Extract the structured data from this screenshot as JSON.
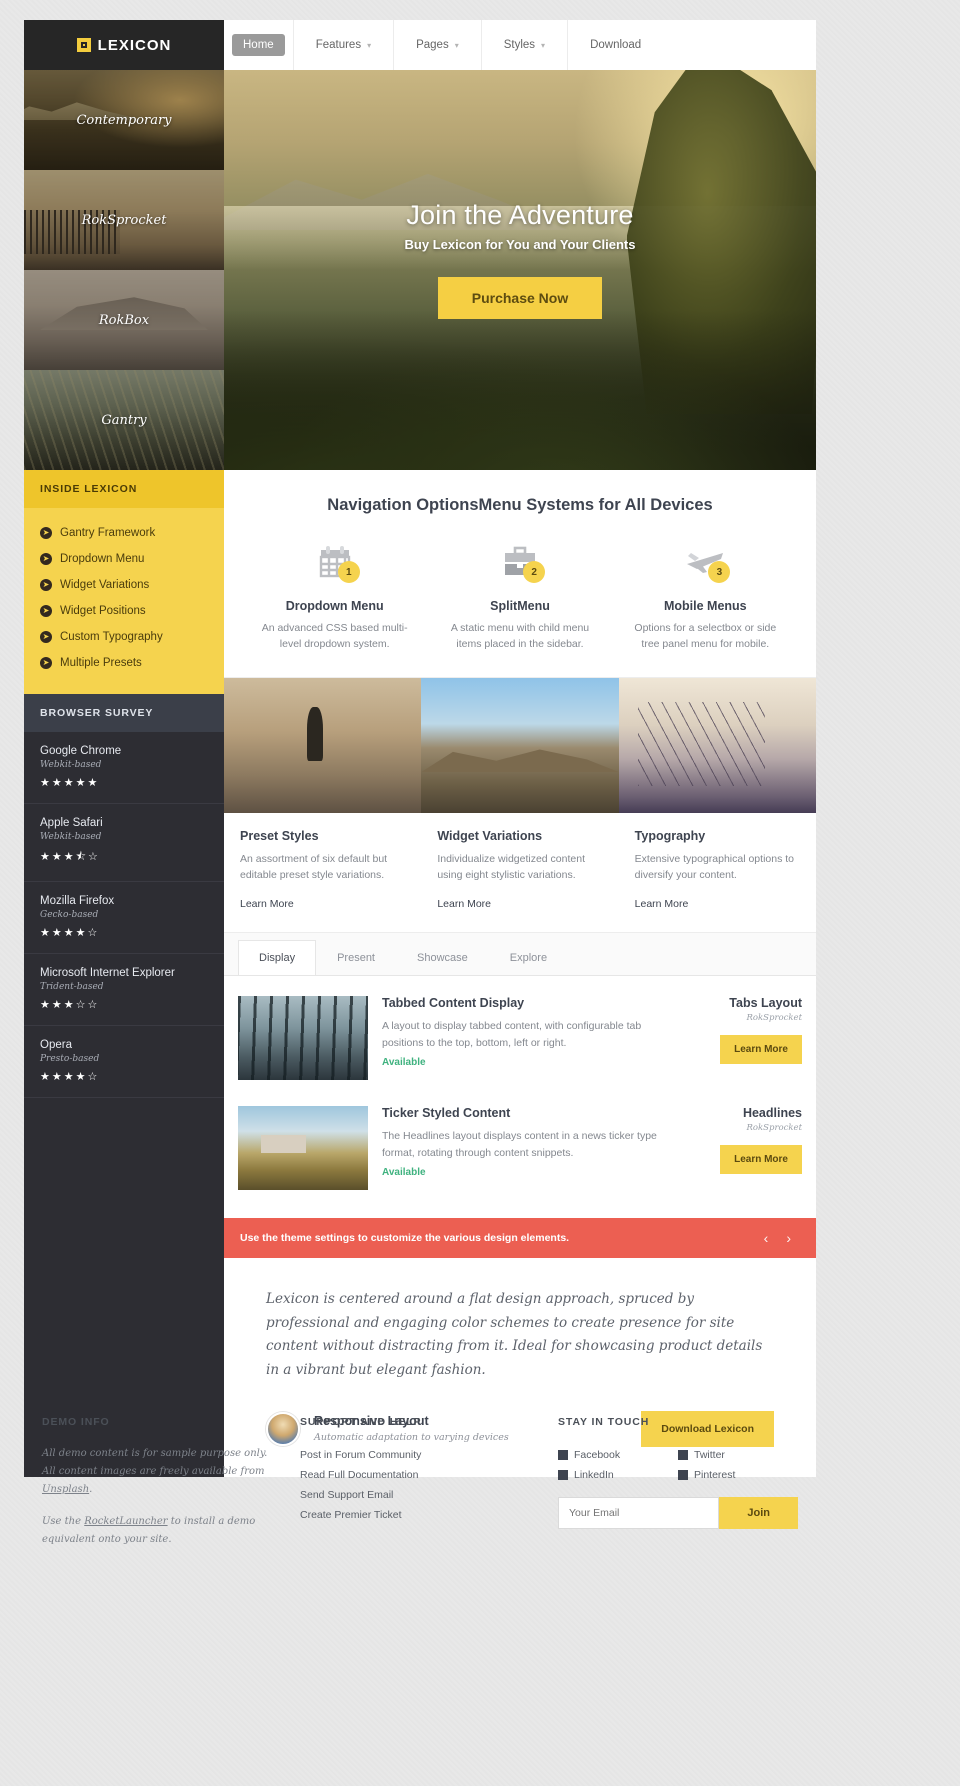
{
  "header": {
    "logo_text": "LEXICON",
    "nav": [
      {
        "label": "Home",
        "caret": false,
        "active": true
      },
      {
        "label": "Features",
        "caret": true,
        "active": false
      },
      {
        "label": "Pages",
        "caret": true,
        "active": false
      },
      {
        "label": "Styles",
        "caret": true,
        "active": false
      },
      {
        "label": "Download",
        "caret": false,
        "active": false
      }
    ]
  },
  "thumbs": [
    {
      "label": "Contemporary"
    },
    {
      "label": "RokSprocket"
    },
    {
      "label": "RokBox"
    },
    {
      "label": "Gantry"
    }
  ],
  "hero": {
    "title": "Join the Adventure",
    "subtitle": "Buy Lexicon for You and Your Clients",
    "button": "Purchase Now"
  },
  "sidebar": {
    "inside_title": "INSIDE LEXICON",
    "inside_links": [
      "Gantry Framework",
      "Dropdown Menu",
      "Widget Variations",
      "Widget Positions",
      "Custom Typography",
      "Multiple Presets"
    ],
    "survey_title": "BROWSER SURVEY",
    "browsers": [
      {
        "name": "Google Chrome",
        "engine": "Webkit-based",
        "rating": 5
      },
      {
        "name": "Apple Safari",
        "engine": "Webkit-based",
        "rating": 3.5
      },
      {
        "name": "Mozilla Firefox",
        "engine": "Gecko-based",
        "rating": 4
      },
      {
        "name": "Microsoft Internet Explorer",
        "engine": "Trident-based",
        "rating": 3
      },
      {
        "name": "Opera",
        "engine": "Presto-based",
        "rating": 4
      }
    ]
  },
  "navopt": {
    "heading": "Navigation OptionsMenu Systems for All Devices",
    "features": [
      {
        "badge": "1",
        "icon": "calendar-icon",
        "title": "Dropdown Menu",
        "desc": "An advanced CSS based multi-level dropdown system."
      },
      {
        "badge": "2",
        "icon": "briefcase-icon",
        "title": "SplitMenu",
        "desc": "A static menu with child menu items placed in the sidebar."
      },
      {
        "badge": "3",
        "icon": "airplane-icon",
        "title": "Mobile Menus",
        "desc": "Options for a selectbox or side tree panel menu for mobile."
      }
    ]
  },
  "cards": [
    {
      "title": "Preset Styles",
      "desc": "An assortment of six default but editable preset style variations.",
      "link": "Learn More"
    },
    {
      "title": "Widget Variations",
      "desc": "Individualize widgetized content using eight stylistic variations.",
      "link": "Learn More"
    },
    {
      "title": "Typography",
      "desc": "Extensive typographical options to diversify your content.",
      "link": "Learn More"
    }
  ],
  "tabs": {
    "items": [
      "Display",
      "Present",
      "Showcase",
      "Explore"
    ],
    "active": "Display",
    "rows": [
      {
        "title": "Tabbed Content Display",
        "desc": "A layout to display tabbed content, with configurable tab positions to the top, bottom, left or right.",
        "status": "Available",
        "side_title": "Tabs Layout",
        "side_sub": "RokSprocket",
        "button": "Learn More"
      },
      {
        "title": "Ticker Styled Content",
        "desc": "The Headlines layout displays content in a news ticker type format, rotating through content snippets.",
        "status": "Available",
        "side_title": "Headlines",
        "side_sub": "RokSprocket",
        "button": "Learn More"
      }
    ]
  },
  "notice": {
    "message": "Use the theme settings to customize the various design elements.",
    "prev": "‹",
    "next": "›"
  },
  "quote_section": {
    "quote": "Lexicon is centered around a flat design approach, spruced by professional and engaging color schemes to create presence for site content without distracting from it. Ideal for showcasing product details in a vibrant but elegant fashion.",
    "feature_title": "Responsive Layout",
    "feature_sub": "Automatic adaptation to varying devices",
    "download_button": "Download Lexicon"
  },
  "footer": {
    "demo": {
      "title": "DEMO INFO",
      "p1_a": "All demo content is for sample purpose only. All content images are freely available from ",
      "p1_b": "Unsplash",
      "p1_c": ".",
      "p2_a": "Use the ",
      "p2_b": "RocketLauncher",
      "p2_c": " to install a demo equivalent onto your site."
    },
    "support": {
      "title": "SUPPORT AND HELP",
      "links": [
        "Post in Forum Community",
        "Read Full Documentation",
        "Send Support Email",
        "Create Premier Ticket"
      ]
    },
    "social": {
      "title": "STAY IN TOUCH",
      "links": [
        "Facebook",
        "Twitter",
        "LinkedIn",
        "Pinterest"
      ],
      "email_placeholder": "Your Email",
      "join_button": "Join"
    }
  },
  "colors": {
    "accent_yellow": "#f5d34e",
    "dark_sidebar": "#2d2d33",
    "notice_red": "#ec5f52",
    "available_green": "#3fb27f"
  }
}
